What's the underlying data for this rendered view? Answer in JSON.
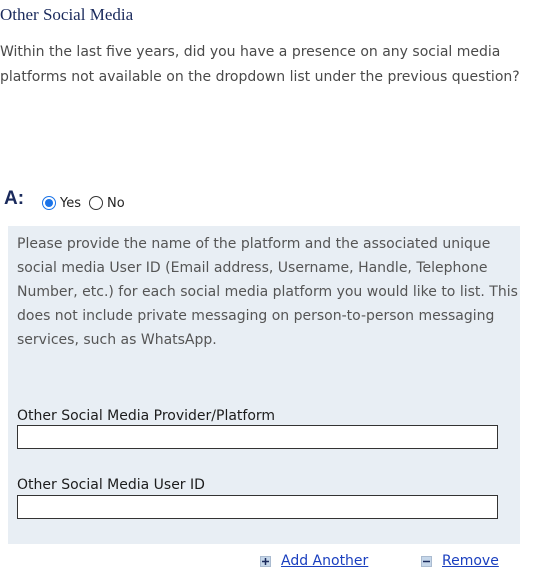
{
  "section": {
    "title": "Other Social Media",
    "question": "Within the last five years, did you have a presence on any social media platforms not available on the dropdown list under the previous question?"
  },
  "answer": {
    "label": "A:",
    "options": [
      {
        "label": "Yes",
        "selected": true
      },
      {
        "label": "No",
        "selected": false
      }
    ]
  },
  "details": {
    "instructions": "Please provide the name of the platform and the associated unique social media User ID (Email address, Username, Handle, Telephone Number, etc.) for each social media platform you would like to list. This does not include private messaging on person-to-person messaging services, such as WhatsApp.",
    "fields": [
      {
        "label": "Other Social Media Provider/Platform",
        "value": ""
      },
      {
        "label": "Other Social Media User ID",
        "value": ""
      }
    ]
  },
  "actions": {
    "add_label": "Add Another",
    "remove_label": "Remove"
  },
  "colors": {
    "heading": "#1a2a5c",
    "panel_background": "#e8eef4",
    "radio_selected": "#1a73e8",
    "link": "#1a3fbf"
  }
}
